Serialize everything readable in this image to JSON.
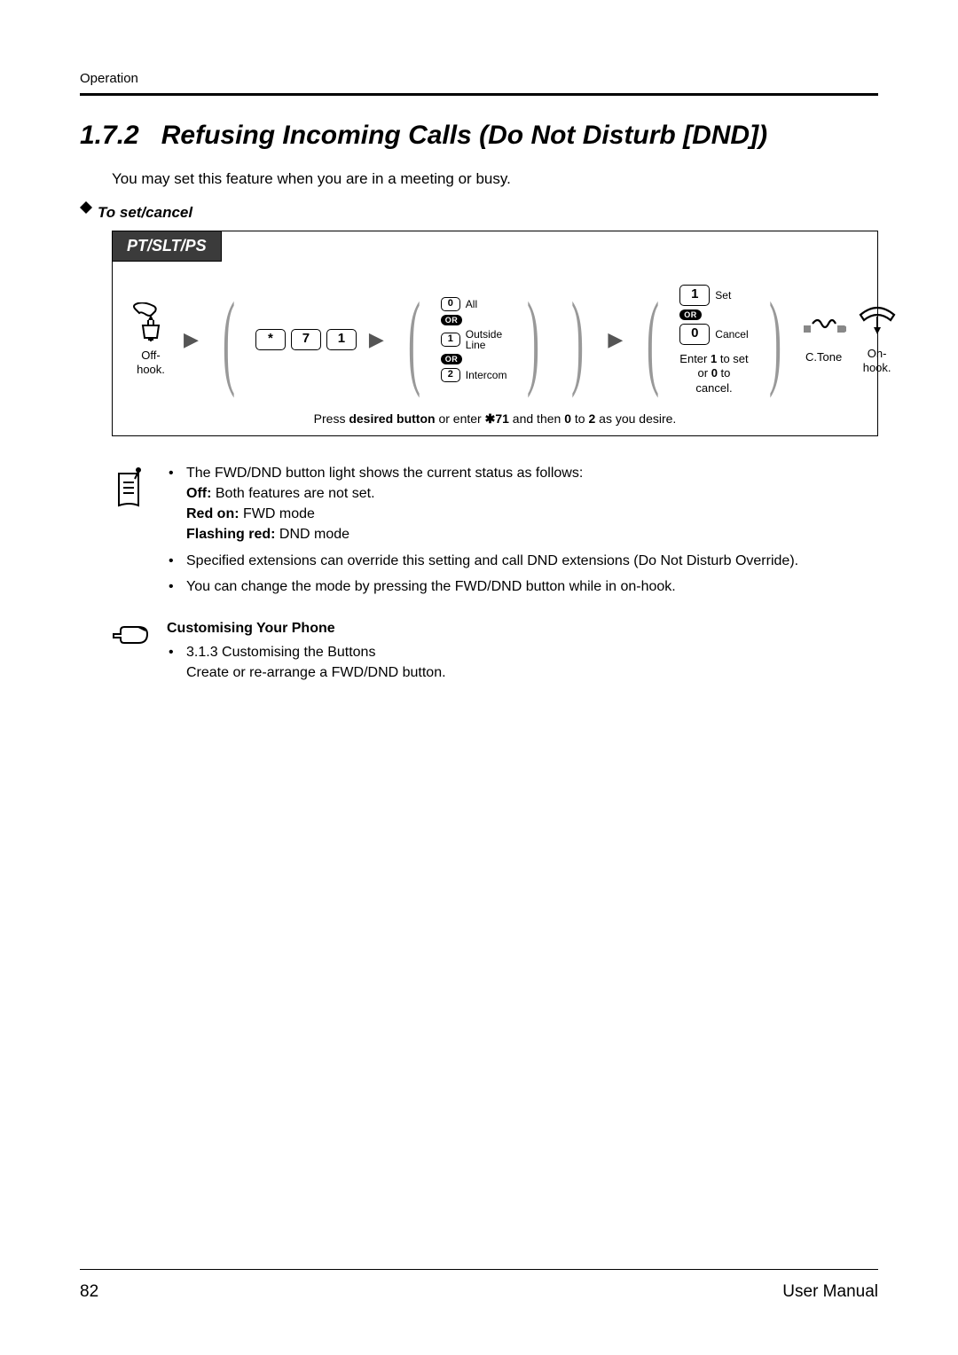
{
  "running_head": "Operation",
  "section_number": "1.7.2",
  "section_title": "Refusing Incoming Calls (Do Not Disturb [DND])",
  "intro": "You may set this feature when you are in a meeting or busy.",
  "subhead": "To set/cancel",
  "flow": {
    "tab": "PT/SLT/PS",
    "offhook": "Off-hook.",
    "dial": {
      "star": "*",
      "d7": "7",
      "d1": "1"
    },
    "options": {
      "k0": "0",
      "l0": "All",
      "or": "OR",
      "k1": "1",
      "l1": "Outside Line",
      "k2": "2",
      "l2": "Intercom"
    },
    "setcancel": {
      "k1": "1",
      "l1": "Set",
      "or": "OR",
      "k0": "0",
      "l0": "Cancel",
      "caption_a": "Enter 1 to set",
      "caption_b": "or 0 to cancel."
    },
    "ctone": "C.Tone",
    "onhook": "On-hook.",
    "caption_pre": "Press ",
    "caption_bold1": "desired button",
    "caption_mid1": " or enter ",
    "caption_bold2": "*71",
    "caption_mid2": " and then ",
    "caption_bold3": "0",
    "caption_mid3": " to ",
    "caption_bold4": "2",
    "caption_end": " as you desire."
  },
  "notes1": {
    "b1": "The FWD/DND button light shows the current status as follows:",
    "off_label": "Off:",
    "off_text": " Both features are not set.",
    "red_label": "Red on:",
    "red_text": " FWD mode",
    "flash_label": "Flashing red:",
    "flash_text": " DND mode",
    "b2": "Specified extensions can override this setting and call DND extensions (Do Not Disturb Override).",
    "b3": "You can change the mode by pressing the FWD/DND button while in on-hook."
  },
  "notes2": {
    "heading": "Customising Your Phone",
    "ref": "3.1.3   Customising the Buttons",
    "desc": "Create or re-arrange a FWD/DND button."
  },
  "footer": {
    "page": "82",
    "title": "User Manual"
  }
}
